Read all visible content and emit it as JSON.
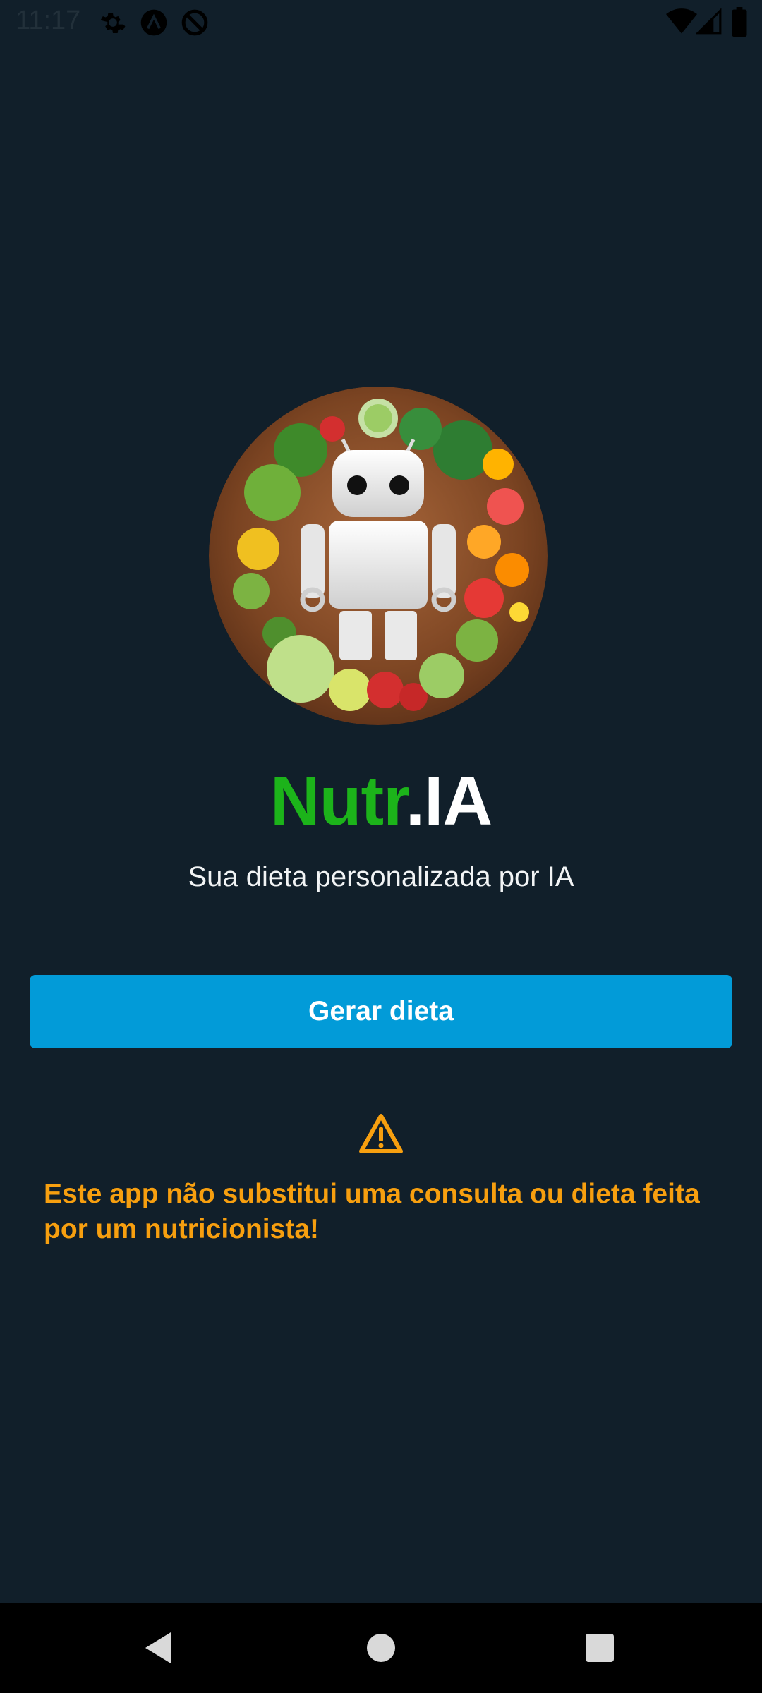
{
  "status_bar": {
    "time": "11:17",
    "icons_left": [
      "gear-icon",
      "a-circle-icon",
      "dnd-icon"
    ],
    "icons_right": [
      "wifi-icon",
      "signal-icon",
      "battery-icon"
    ]
  },
  "hero": {
    "image": "robot-with-vegetables-illustration"
  },
  "app": {
    "title_part1": "Nutr",
    "title_part2": ".IA",
    "subtitle": "Sua dieta personalizada por IA"
  },
  "actions": {
    "generate_label": "Gerar dieta"
  },
  "disclaimer": {
    "icon": "warning-icon",
    "text": "Este app não substitui uma consulta ou dieta feita por um nutricionista!"
  },
  "navigation": {
    "buttons": [
      "back",
      "home",
      "recents"
    ]
  },
  "colors": {
    "background": "#111f2a",
    "accent_green": "#1cb31a",
    "button_blue": "#029bd8",
    "warning_orange": "#f79f0f"
  }
}
